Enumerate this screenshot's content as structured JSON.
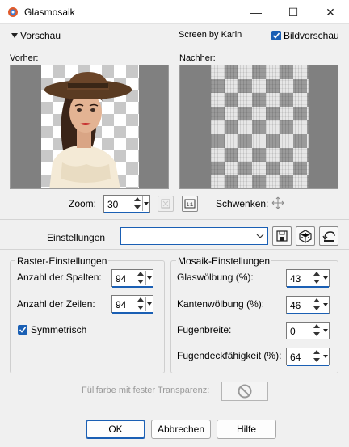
{
  "window": {
    "title": "Glasmosaik",
    "minimize": "—",
    "maximize": "☐",
    "close": "✕"
  },
  "preview_bar": {
    "section_label": "Vorschau",
    "credit": "Screen by Karin",
    "live_preview_label": "Bildvorschau",
    "live_preview_checked": true
  },
  "previews": {
    "before_label": "Vorher:",
    "after_label": "Nachher:"
  },
  "zoom": {
    "label": "Zoom:",
    "value": "30",
    "pan_label": "Schwenken:"
  },
  "presets": {
    "label": "Einstellungen",
    "value": ""
  },
  "raster": {
    "title": "Raster-Einstellungen",
    "columns_label": "Anzahl der Spalten:",
    "columns_value": "94",
    "rows_label": "Anzahl der Zeilen:",
    "rows_value": "94",
    "symmetric_label": "Symmetrisch",
    "symmetric_checked": true
  },
  "mosaic": {
    "title": "Mosaik-Einstellungen",
    "glass_curvature_label": "Glaswölbung (%):",
    "glass_curvature_value": "43",
    "edge_curvature_label": "Kantenwölbung (%):",
    "edge_curvature_value": "46",
    "grout_width_label": "Fugenbreite:",
    "grout_width_value": "0",
    "grout_opacity_label": "Fugendeckfähigkeit (%):",
    "grout_opacity_value": "64"
  },
  "fill": {
    "label": "Füllfarbe mit fester Transparenz:"
  },
  "buttons": {
    "ok": "OK",
    "cancel": "Abbrechen",
    "help": "Hilfe"
  },
  "colors": {
    "accent": "#1a5fb4",
    "background": "#f0f0f0",
    "preview_gray": "#808080"
  }
}
